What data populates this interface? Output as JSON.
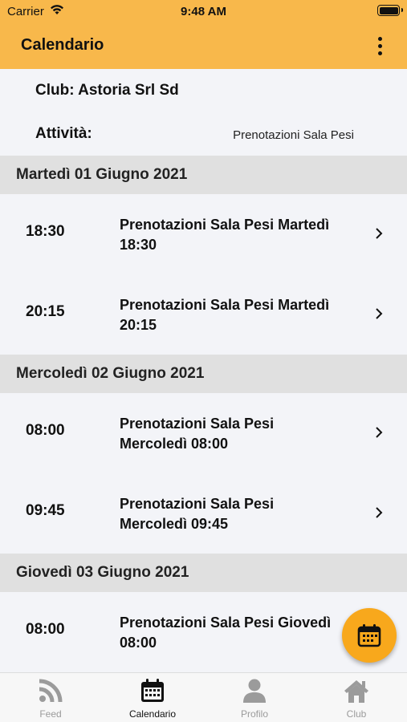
{
  "status_bar": {
    "carrier": "Carrier",
    "time": "9:48 AM"
  },
  "app_bar": {
    "title": "Calendario"
  },
  "filters": {
    "club_label": "Club: Astoria Srl Sd",
    "activity_label": "Attività:",
    "activity_value": "Prenotazioni Sala Pesi"
  },
  "days": [
    {
      "title": "Martedì 01 Giugno 2021",
      "sessions": [
        {
          "time": "18:30",
          "name": "Prenotazioni Sala Pesi Martedì\n18:30"
        },
        {
          "time": "20:15",
          "name": "Prenotazioni Sala Pesi Martedì\n20:15"
        }
      ]
    },
    {
      "title": "Mercoledì 02 Giugno 2021",
      "sessions": [
        {
          "time": "08:00",
          "name": "Prenotazioni Sala Pesi\nMercoledì 08:00"
        },
        {
          "time": "09:45",
          "name": "Prenotazioni Sala Pesi\nMercoledì 09:45"
        }
      ]
    },
    {
      "title": "Giovedì 03 Giugno 2021",
      "sessions": [
        {
          "time": "08:00",
          "name": "Prenotazioni Sala Pesi Giovedì\n08:00"
        }
      ]
    }
  ],
  "fab": {
    "icon": "calendar-icon"
  },
  "tabs": [
    {
      "label": "Feed",
      "icon": "rss-icon",
      "active": false
    },
    {
      "label": "Calendario",
      "icon": "calendar-icon",
      "active": true
    },
    {
      "label": "Profilo",
      "icon": "person-icon",
      "active": false
    },
    {
      "label": "Club",
      "icon": "home-icon",
      "active": false
    }
  ],
  "colors": {
    "accent": "#f8b84b",
    "fab": "#f8a81c",
    "day_header_bg": "#e0e0e0",
    "background": "#f3f4f8"
  }
}
